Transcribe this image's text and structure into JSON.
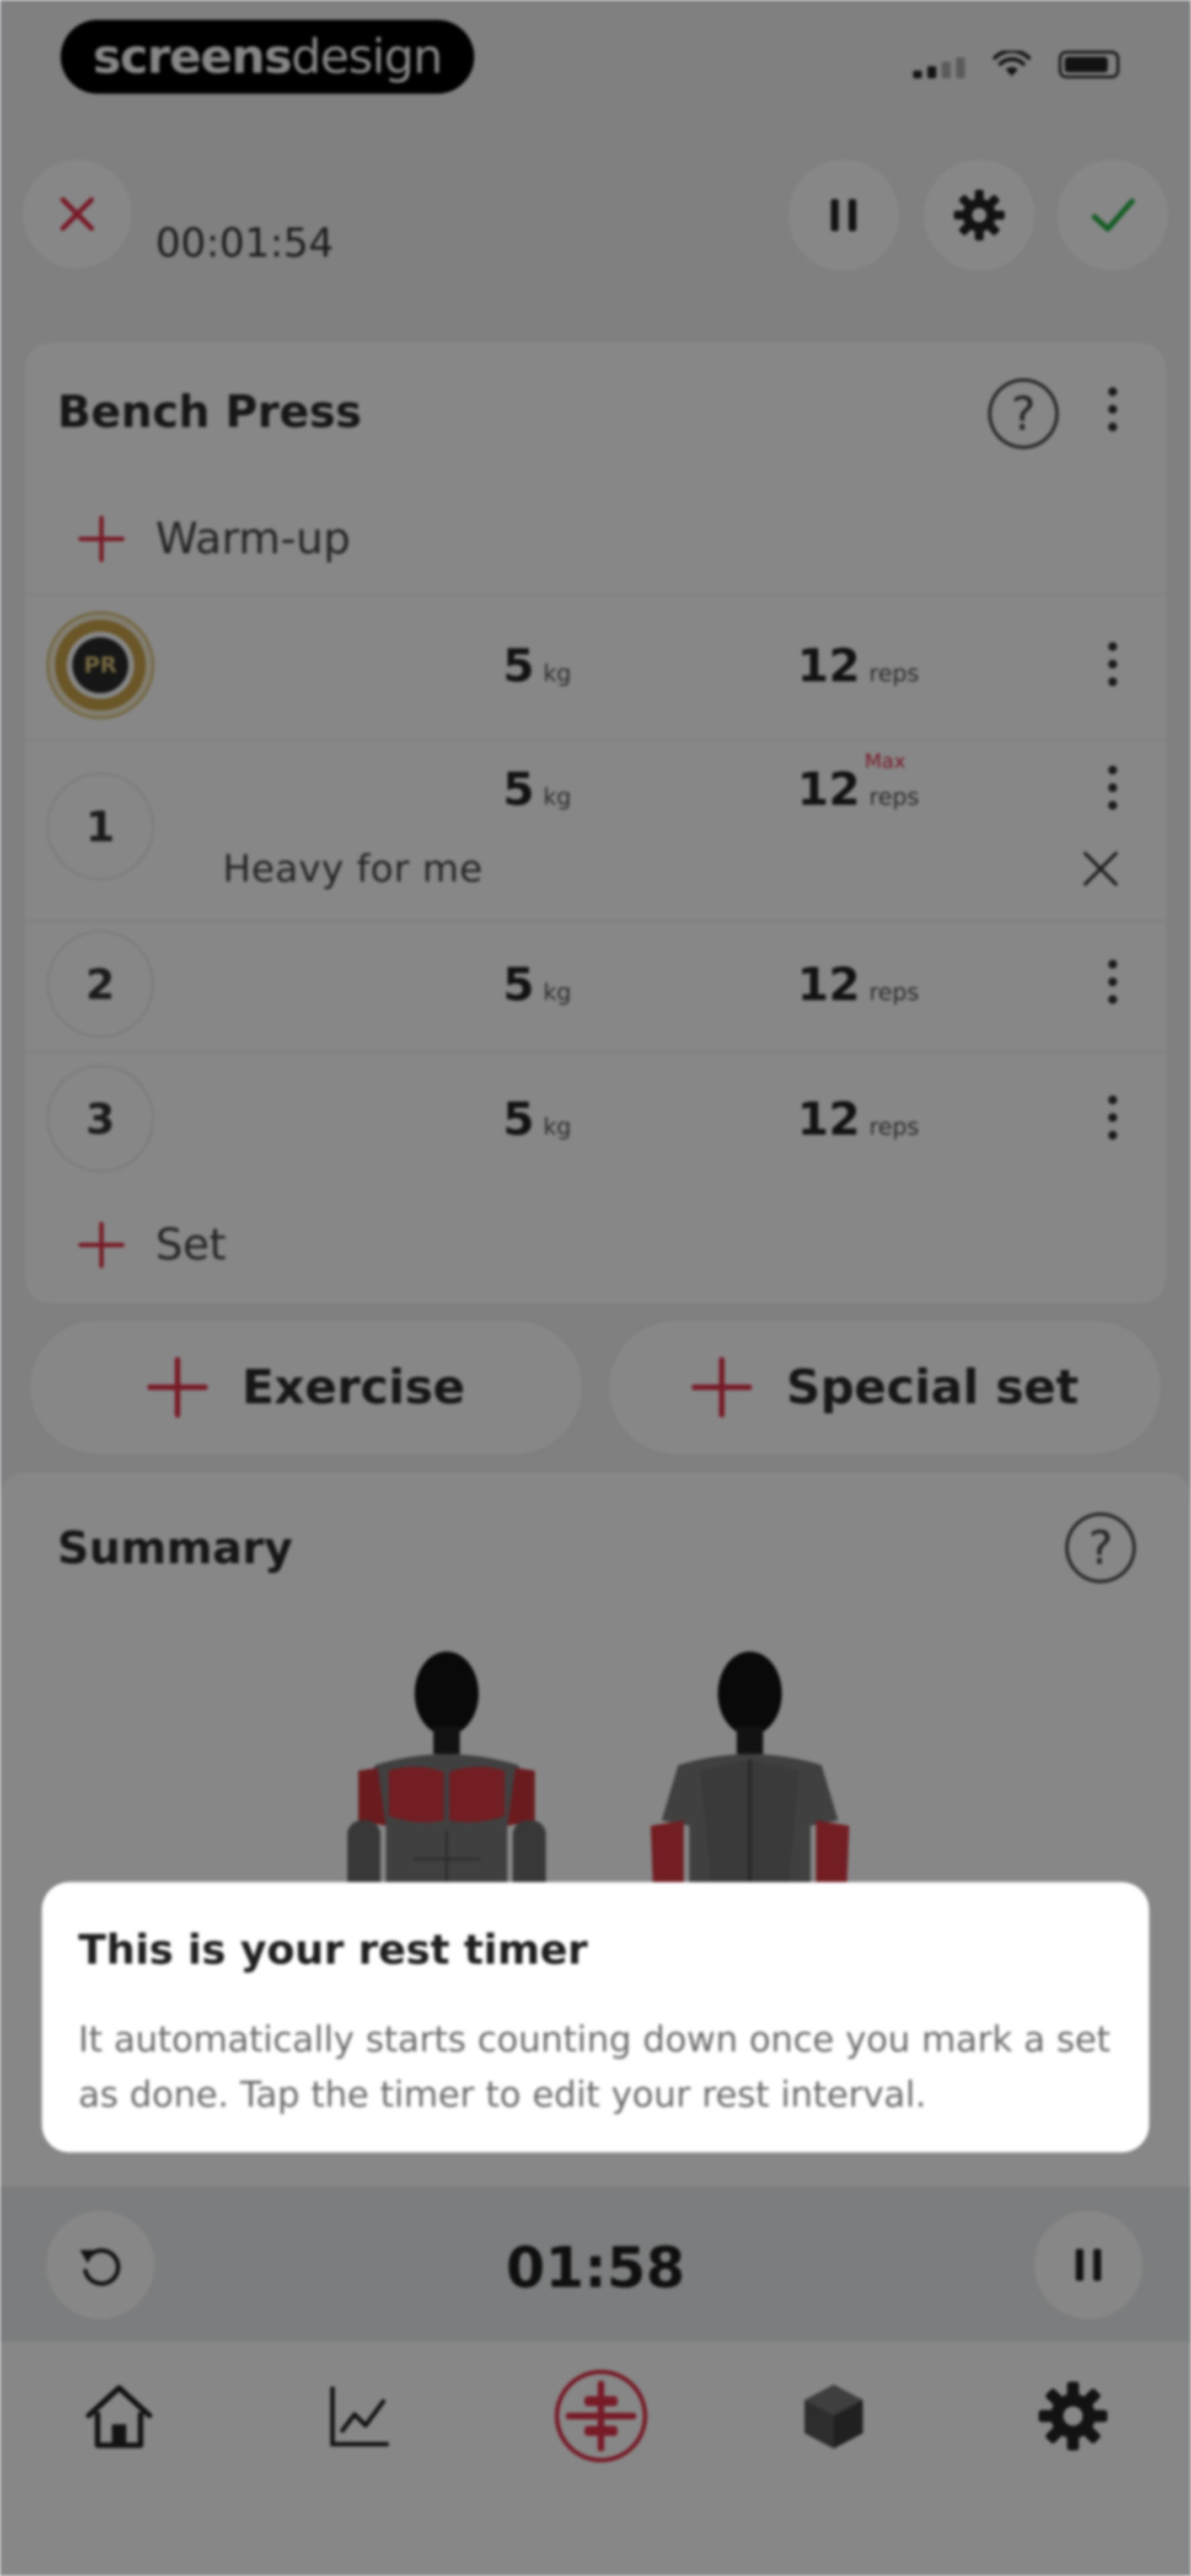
{
  "status_bar": {
    "brand_bold": "screens",
    "brand_light": "design"
  },
  "workout": {
    "elapsed": "00:01:54"
  },
  "exercise": {
    "title": "Bench Press",
    "warmup_label": "Warm-up",
    "sets": [
      {
        "badge": "PR",
        "weight": "5",
        "weight_unit": "kg",
        "reps": "12",
        "reps_unit": "reps"
      },
      {
        "badge": "1",
        "weight": "5",
        "weight_unit": "kg",
        "reps": "12",
        "reps_unit": "reps",
        "max_label": "Max",
        "note": "Heavy for me"
      },
      {
        "badge": "2",
        "weight": "5",
        "weight_unit": "kg",
        "reps": "12",
        "reps_unit": "reps"
      },
      {
        "badge": "3",
        "weight": "5",
        "weight_unit": "kg",
        "reps": "12",
        "reps_unit": "reps"
      }
    ],
    "add_set_label": "Set"
  },
  "actions": {
    "exercise_label": "Exercise",
    "special_set_label": "Special set"
  },
  "summary": {
    "title": "Summary"
  },
  "tooltip": {
    "title": "This is your rest timer",
    "body": "It automatically starts counting down once you mark a set as done. Tap the timer to edit your rest interval."
  },
  "rest_timer": {
    "time": "01:58"
  },
  "nav": {
    "items": [
      {
        "icon": "home-icon"
      },
      {
        "icon": "chart-icon"
      },
      {
        "icon": "workout-icon",
        "active": true
      },
      {
        "icon": "cube-icon"
      },
      {
        "icon": "settings-icon"
      }
    ]
  },
  "colors": {
    "accent": "#e0344a",
    "check": "#2fb24c",
    "muscle_highlight": "#d83a40"
  }
}
